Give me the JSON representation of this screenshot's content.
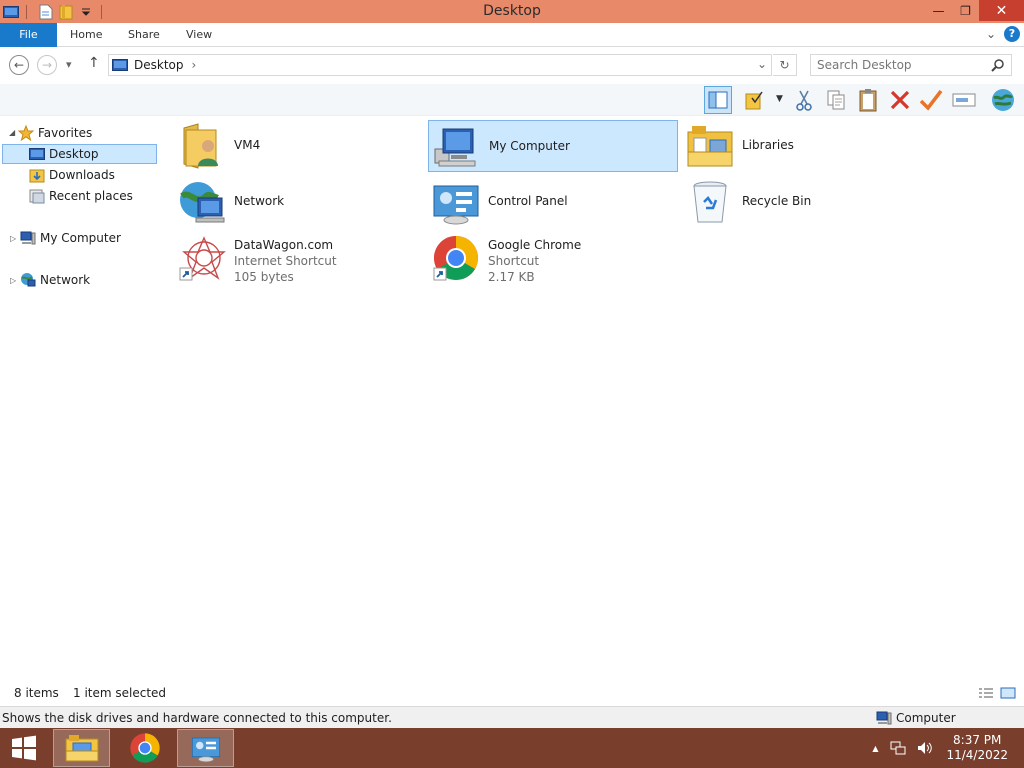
{
  "window": {
    "title": "Desktop"
  },
  "title_buttons": {
    "minimize": "—",
    "restore": "❐",
    "close": "✕"
  },
  "ribbon": {
    "tabs": [
      {
        "label": "File"
      },
      {
        "label": "Home"
      },
      {
        "label": "Share"
      },
      {
        "label": "View"
      }
    ],
    "expand_glyph": "⌄",
    "help_glyph": "?"
  },
  "address": {
    "back": "←",
    "forward": "→",
    "recent": "▾",
    "up": "↑",
    "path_label": "Desktop",
    "path_arrow": "›",
    "dropdown": "⌄",
    "refresh": "↻",
    "search_placeholder": "Search Desktop"
  },
  "navigation": {
    "favorites": {
      "label": "Favorites",
      "items": [
        {
          "label": "Desktop"
        },
        {
          "label": "Downloads"
        },
        {
          "label": "Recent places"
        }
      ]
    },
    "my_computer": "My Computer",
    "network": "Network"
  },
  "content": {
    "items": [
      {
        "name": "VM4",
        "icon": "user-folder-icon"
      },
      {
        "name": "My Computer",
        "icon": "computer-icon"
      },
      {
        "name": "Libraries",
        "icon": "libraries-icon"
      },
      {
        "name": "Network",
        "icon": "network-icon"
      },
      {
        "name": "Control Panel",
        "icon": "control-panel-icon"
      },
      {
        "name": "Recycle Bin",
        "icon": "recycle-bin-icon"
      },
      {
        "name": "DataWagon.com",
        "type": "Internet Shortcut",
        "size": "105 bytes",
        "icon": "datawagon-shortcut-icon"
      },
      {
        "name": "Google Chrome",
        "type": "Shortcut",
        "size": "2.17 KB",
        "icon": "chrome-shortcut-icon"
      }
    ]
  },
  "status": {
    "item_count": "8 items",
    "selection": "1 item selected"
  },
  "info": {
    "message": "Shows the disk drives and hardware connected to this computer.",
    "location": "Computer"
  },
  "taskbar": {
    "time": "8:37 PM",
    "date": "11/4/2022",
    "tray_expand": "▲"
  },
  "colors": {
    "titlebar": "#e8896a",
    "file_tab": "#1979ca",
    "selection": "#cce8ff",
    "taskbar": "#7a3f2c",
    "close": "#c7402f"
  }
}
